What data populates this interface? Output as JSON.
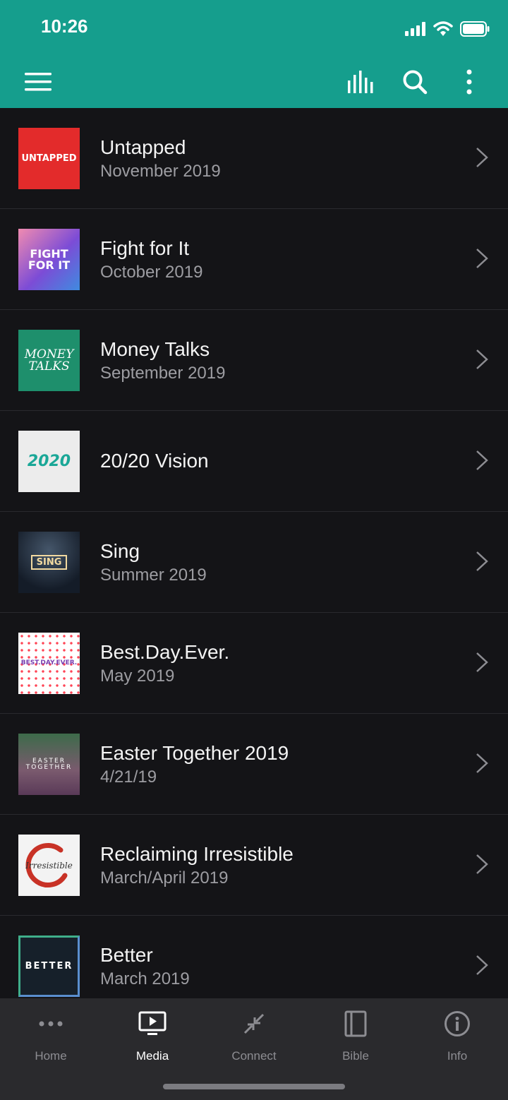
{
  "status_bar": {
    "time": "10:26"
  },
  "toolbar": {
    "menu_icon": "hamburger-menu-icon",
    "audio_icon": "audio-bars-icon",
    "search_icon": "search-icon",
    "more_icon": "more-vertical-icon"
  },
  "series": [
    {
      "title": "Untapped",
      "subtitle": "November 2019",
      "thumb_text": "UNTAPPED"
    },
    {
      "title": "Fight for It",
      "subtitle": "October 2019",
      "thumb_text": "FIGHT FOR IT"
    },
    {
      "title": "Money Talks",
      "subtitle": "September 2019",
      "thumb_text": "MONEY TALKS"
    },
    {
      "title": "20/20 Vision",
      "subtitle": "",
      "thumb_text": "2020"
    },
    {
      "title": "Sing",
      "subtitle": "Summer 2019",
      "thumb_text": "SING"
    },
    {
      "title": "Best.Day.Ever.",
      "subtitle": "May 2019",
      "thumb_text": "BEST.DAY.EVER."
    },
    {
      "title": "Easter Together 2019",
      "subtitle": "4/21/19",
      "thumb_text": "EASTER TOGETHER"
    },
    {
      "title": "Reclaiming Irresistible",
      "subtitle": "March/April 2019",
      "thumb_text": "Irresistible"
    },
    {
      "title": "Better",
      "subtitle": "March 2019",
      "thumb_text": "BETTER"
    }
  ],
  "tabs": [
    {
      "label": "Home",
      "icon": "ellipsis-icon"
    },
    {
      "label": "Media",
      "icon": "media-play-icon"
    },
    {
      "label": "Connect",
      "icon": "connect-arrows-icon"
    },
    {
      "label": "Bible",
      "icon": "bible-book-icon"
    },
    {
      "label": "Info",
      "icon": "info-icon"
    }
  ],
  "colors": {
    "accent": "#159e8d",
    "background": "#141417",
    "tabbar": "#2a2a2d"
  }
}
